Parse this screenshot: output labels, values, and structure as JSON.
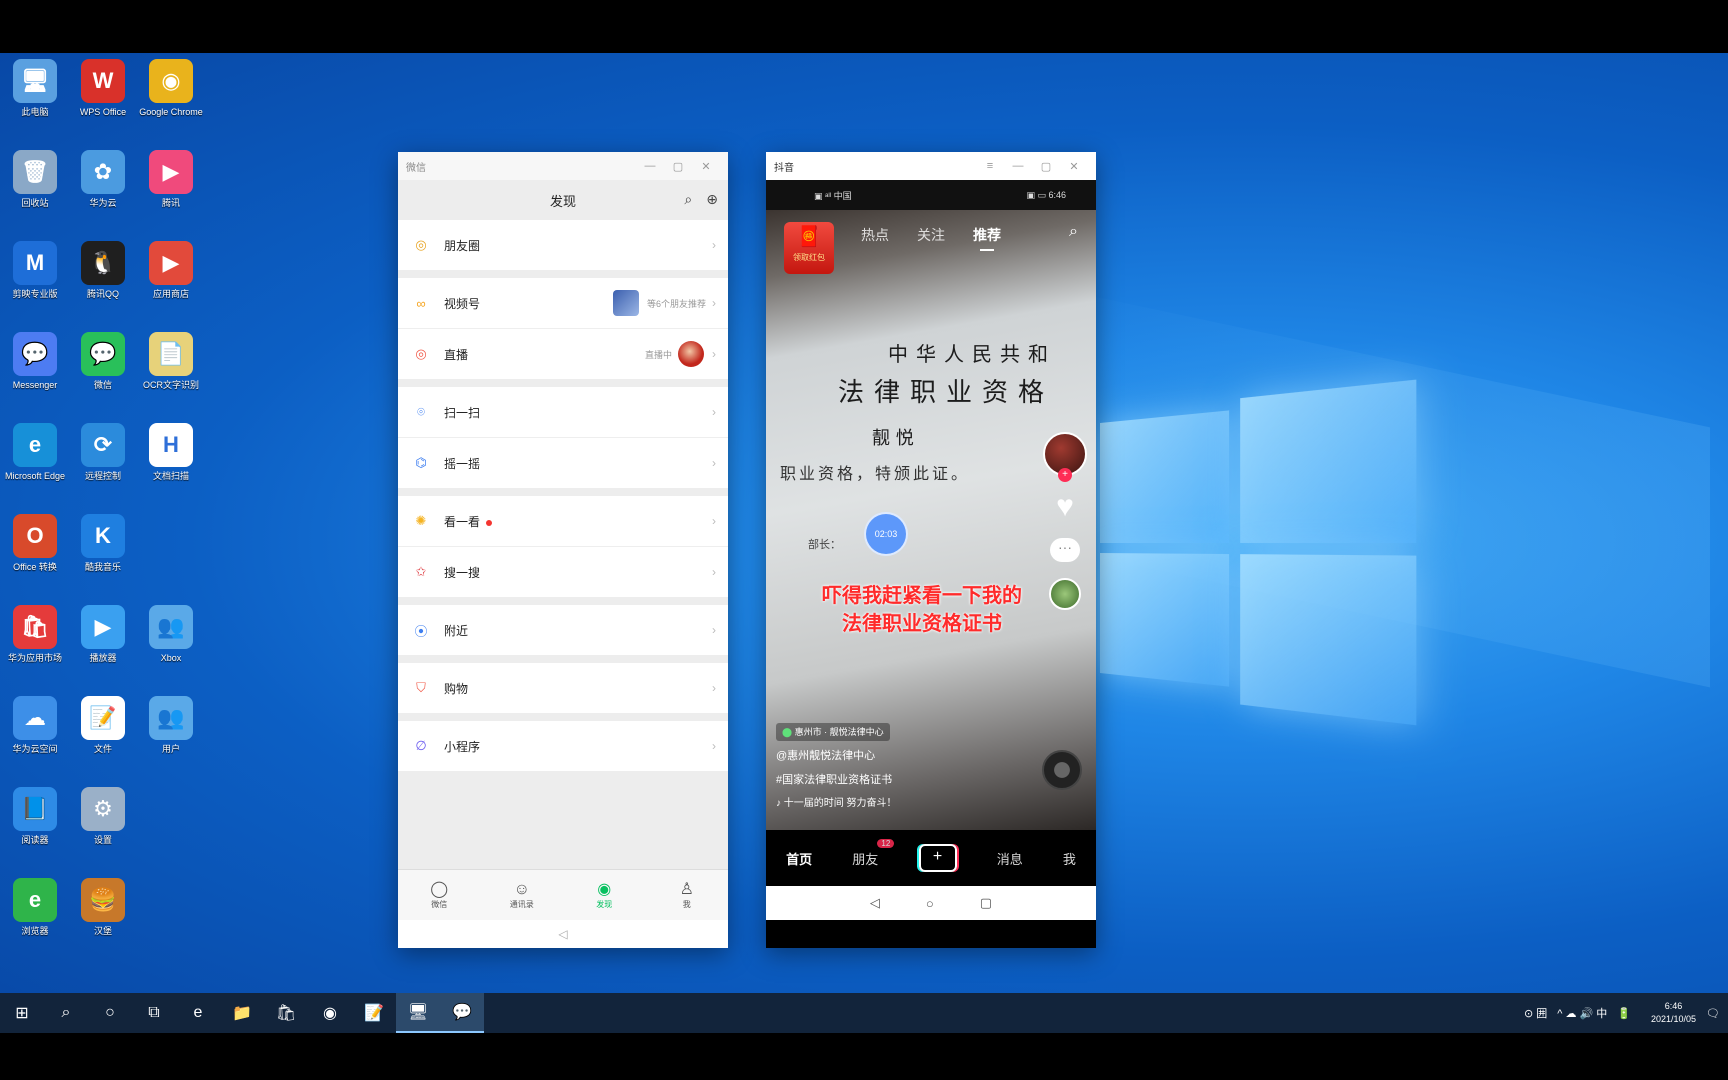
{
  "desktop": {
    "icons": [
      {
        "label": "此电脑",
        "glyph": "🖥",
        "color": "#5aa0e0"
      },
      {
        "label": "WPS Office",
        "glyph": "W",
        "color": "#d9312a"
      },
      {
        "label": "Google Chrome",
        "glyph": "◉",
        "color": "#e9b31c"
      },
      {
        "label": "回收站",
        "glyph": "🗑",
        "color": "#8aa8c7"
      },
      {
        "label": "华为云",
        "glyph": "✿",
        "color": "#4b9be0"
      },
      {
        "label": "腾讯",
        "glyph": "▶",
        "color": "#f04a7c"
      },
      {
        "label": "剪映专业版",
        "glyph": "M",
        "color": "#1e6ed8"
      },
      {
        "label": "腾讯QQ",
        "glyph": "🐧",
        "color": "#1f1f1f"
      },
      {
        "label": "应用商店",
        "glyph": "▶",
        "color": "#e24a3b"
      },
      {
        "label": "Messenger",
        "glyph": "💬",
        "color": "#4d7cf2"
      },
      {
        "label": "微信",
        "glyph": "💬",
        "color": "#29c05a"
      },
      {
        "label": "OCR文字识别",
        "glyph": "📄",
        "color": "#e7d27a"
      },
      {
        "label": "Microsoft Edge",
        "glyph": "e",
        "color": "#1790d8"
      },
      {
        "label": "远程控制",
        "glyph": "⟳",
        "color": "#2b8bdc"
      },
      {
        "label": "文档扫描",
        "glyph": "H",
        "color": "#ffffff"
      },
      {
        "label": "Office 转换",
        "glyph": "O",
        "color": "#d84a2b"
      },
      {
        "label": "酷我音乐",
        "glyph": "K",
        "color": "#1f7fe0"
      },
      {
        "label": "华为应用市场",
        "glyph": "🛍",
        "color": "#e53b3b"
      },
      {
        "label": "播放器",
        "glyph": "▶",
        "color": "#3aa0f0"
      },
      {
        "label": "Xbox",
        "glyph": "👥",
        "color": "#5aa9e8"
      },
      {
        "label": "华为云空间",
        "glyph": "☁",
        "color": "#3d8fe8"
      },
      {
        "label": "文件",
        "glyph": "📝",
        "color": "#ffffff"
      },
      {
        "label": "用户",
        "glyph": "👥",
        "color": "#5aa9e8"
      },
      {
        "label": "阅读器",
        "glyph": "📘",
        "color": "#2e8be6"
      },
      {
        "label": "设置",
        "glyph": "⚙",
        "color": "#9ab0c8"
      },
      {
        "label": "浏览器",
        "glyph": "e",
        "color": "#2fb44a"
      },
      {
        "label": "汉堡",
        "glyph": "🍔",
        "color": "#c7782a"
      }
    ]
  },
  "wechat": {
    "window_title": "微信",
    "header_title": "发现",
    "groups": [
      [
        {
          "label": "朋友圈",
          "icon": "◎",
          "icon_color": "#e8a524"
        }
      ],
      [
        {
          "label": "视频号",
          "icon": "∞",
          "icon_color": "#f5a623",
          "extra": "等6个朋友推荐"
        },
        {
          "label": "直播",
          "icon": "◎",
          "icon_color": "#f15b4a",
          "extra": "直播中"
        }
      ],
      [
        {
          "label": "扫一扫",
          "icon": "⌾",
          "icon_color": "#3d7ef0"
        },
        {
          "label": "摇一摇",
          "icon": "⌬",
          "icon_color": "#3d7ef0"
        }
      ],
      [
        {
          "label": "看一看",
          "icon": "✺",
          "icon_color": "#f5b321",
          "dot": true
        },
        {
          "label": "搜一搜",
          "icon": "✩",
          "icon_color": "#e0464b"
        }
      ],
      [
        {
          "label": "附近",
          "icon": "⦿",
          "icon_color": "#3d7ef0"
        }
      ],
      [
        {
          "label": "购物",
          "icon": "⛉",
          "icon_color": "#f15b4a"
        }
      ],
      [
        {
          "label": "小程序",
          "icon": "∅",
          "icon_color": "#6d5ef0"
        }
      ]
    ],
    "tabs": [
      {
        "label": "微信",
        "icon": "◯"
      },
      {
        "label": "通讯录",
        "icon": "☺"
      },
      {
        "label": "发现",
        "icon": "◉"
      },
      {
        "label": "我",
        "icon": "♙"
      }
    ],
    "active_tab": 2
  },
  "douyin": {
    "window_title": "抖音",
    "status_left": "▣ ᵃˡˡ 中国",
    "status_right": "▣ ▭ 6:46",
    "top_tabs": [
      "热点",
      "关注",
      "推荐"
    ],
    "active_top_tab": 2,
    "certificate": {
      "line1": "中华人民共和",
      "line2": "法律职业资格",
      "line3": "靓 悦",
      "line4": "职业资格，特颁此证。",
      "line5": "部长："
    },
    "overlay_line1": "吓得我赶紧看一下我的",
    "overlay_line2": "法律职业资格证书",
    "badge_text": "领取红包",
    "location": "惠州市 · 靓悦法律中心",
    "account": "@惠州靓悦法律中心",
    "hashtag": "#国家法律职业资格证书",
    "music": "♪ 十一届的时间  努力奋斗！",
    "play_label": "02:03",
    "bottom_tabs": [
      "首页",
      "朋友",
      "+",
      "消息",
      "我"
    ],
    "friends_badge": "12",
    "nav": [
      "◁",
      "○",
      "▢"
    ]
  },
  "taskbar": {
    "items": [
      "⊞",
      "⌕",
      "○",
      "⧉",
      "e",
      "📁",
      "🛍",
      "◉",
      "📝",
      "🖥",
      "💬"
    ],
    "active_indices": [
      9,
      10
    ],
    "tray": [
      "⊙ 囲",
      "^ ☁ 🔊 中",
      "🔋"
    ],
    "time": "6:46",
    "date": "2021/10/05"
  }
}
